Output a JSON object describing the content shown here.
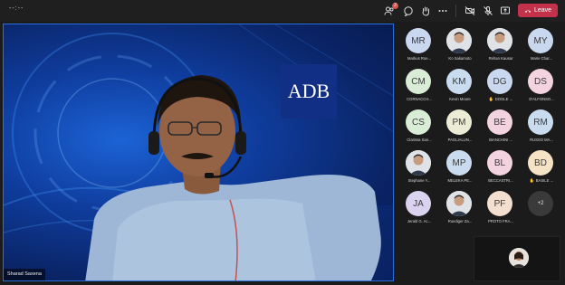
{
  "topbar": {
    "timer": "--:--",
    "participants_badge": "2",
    "leave_label": "Leave"
  },
  "main_video": {
    "presenter_name": "Sharad Saxena",
    "logo_text": "ADB"
  },
  "participants": [
    {
      "initials": "MR",
      "name": "Markus Roe...",
      "color": "#c9d8ef",
      "photo": false,
      "hand": false
    },
    {
      "initials": "",
      "name": "Ko Sakamoto",
      "color": "#cfd6df",
      "photo": true,
      "hand": false
    },
    {
      "initials": "",
      "name": "Rehan Kausar",
      "color": "#cfd6df",
      "photo": true,
      "hand": false
    },
    {
      "initials": "MY",
      "name": "Marie Char...",
      "color": "#c9d8ef",
      "photo": false,
      "hand": false
    },
    {
      "initials": "CM",
      "name": "CORNACCH...",
      "color": "#d8ecd6",
      "photo": false,
      "hand": false
    },
    {
      "initials": "KM",
      "name": "Kevin Moore",
      "color": "#c9dcef",
      "photo": false,
      "hand": false
    },
    {
      "initials": "DG",
      "name": "DOGLE ...",
      "color": "#c9d8ef",
      "photo": false,
      "hand": true
    },
    {
      "initials": "DS",
      "name": "D'ALFONSO...",
      "color": "#f3d3df",
      "photo": false,
      "hand": false
    },
    {
      "initials": "CS",
      "name": "Clarissa San...",
      "color": "#d8ecd6",
      "photo": false,
      "hand": false
    },
    {
      "initials": "PM",
      "name": "PAGLIALUN...",
      "color": "#ececd6",
      "photo": false,
      "hand": false
    },
    {
      "initials": "BE",
      "name": "BIANCHINI ...",
      "color": "#f3d3df",
      "photo": false,
      "hand": false
    },
    {
      "initials": "RM",
      "name": "RUSSO MA...",
      "color": "#c9dcef",
      "photo": false,
      "hand": false
    },
    {
      "initials": "",
      "name": "Stephane Y...",
      "color": "#cfd6df",
      "photo": true,
      "hand": false
    },
    {
      "initials": "MP",
      "name": "MELEKA PE...",
      "color": "#c9dcef",
      "photo": false,
      "hand": false
    },
    {
      "initials": "BL",
      "name": "BECCASTRI...",
      "color": "#f3d3df",
      "photo": false,
      "hand": false
    },
    {
      "initials": "BD",
      "name": "BASILE ...",
      "color": "#f6e3c6",
      "photo": false,
      "hand": true
    },
    {
      "initials": "JA",
      "name": "Jerald G. Ac...",
      "color": "#d9d3f0",
      "photo": false,
      "hand": false
    },
    {
      "initials": "",
      "name": "Ruediger Za...",
      "color": "#cfd6df",
      "photo": true,
      "hand": false
    },
    {
      "initials": "PF",
      "name": "PROTO FRA...",
      "color": "#f3dfcf",
      "photo": false,
      "hand": false
    }
  ],
  "more_label": "+2",
  "colors": {
    "leave": "#c4314b",
    "accent": "#2a6fdb"
  }
}
